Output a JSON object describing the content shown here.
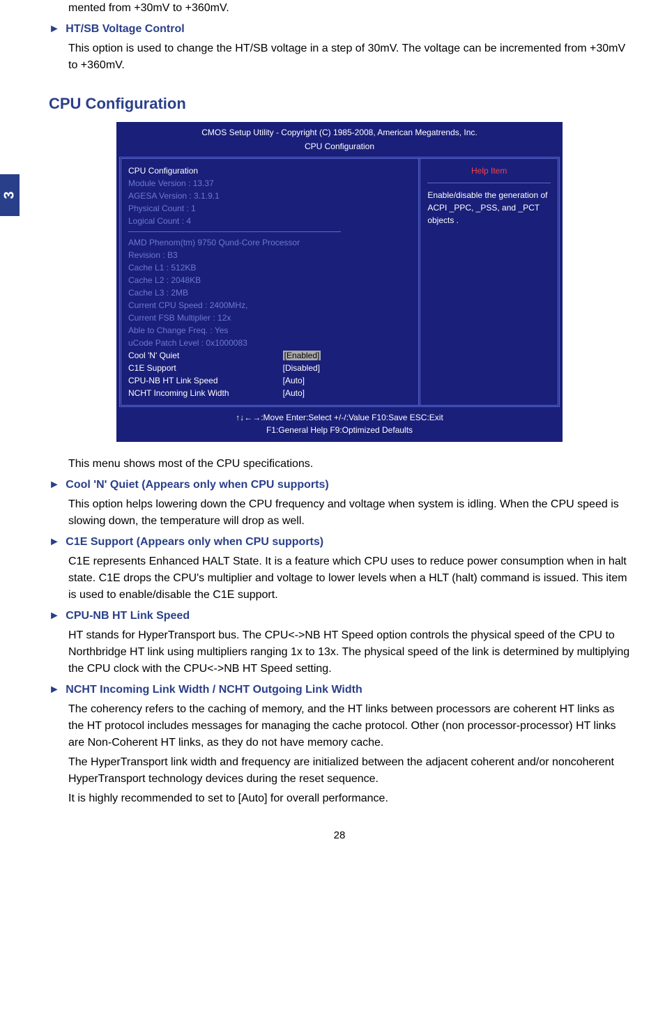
{
  "side_tab": "3",
  "intro_tail": "mented from +30mV to +360mV.",
  "htsb": {
    "title": "HT/SB Voltage Control",
    "body": "This option is used to change the HT/SB voltage in a step of 30mV. The voltage can be incremented from +30mV to +360mV."
  },
  "cpu_config_heading": "CPU Configuration",
  "bios": {
    "title": "CMOS Setup Utility - Copyright (C) 1985-2008, American Megatrends, Inc.",
    "subtitle": "CPU Configuration",
    "left": {
      "heading": "CPU Configuration",
      "module": "Module Version :  13.37",
      "agesa": "AGESA  Version :  3.1.9.1",
      "physical": "Physical Count :  1",
      "logical": "Logical Count :  4",
      "proc": "AMD Phenom(tm) 9750 Qund-Core Processor",
      "rev": "Revision :  B3",
      "l1": "Cache L1 :  512KB",
      "l2": "Cache L2 :  2048KB",
      "l3": "Cache L3 :  2MB",
      "speed": "Current CPU Speed  : 2400MHz,",
      "fsb": "Current FSB Multiplier  : 12x",
      "freq": "Able to Change Freq. : Yes",
      "ucode": "uCode Patch Level    : 0x1000083",
      "rows": [
        {
          "label": "Cool 'N' Quiet",
          "value": "[Enabled]",
          "selected": true
        },
        {
          "label": "C1E Support",
          "value": "[Disabled]",
          "selected": false
        },
        {
          "label": "CPU-NB HT Link Speed",
          "value": "[Auto]",
          "selected": false
        },
        {
          "label": "NCHT Incoming Link Width",
          "value": "[Auto]",
          "selected": false
        }
      ]
    },
    "right": {
      "help_title": "Help Item",
      "help_text": "Enable/disable the generation of ACPI _PPC,  _PSS, and _PCT objects ."
    },
    "footer1": "↑↓←→:Move   Enter:Select     +/-/:Value    F10:Save      ESC:Exit",
    "footer2": "F1:General Help                        F9:Optimized Defaults"
  },
  "after_bios_intro": "This menu shows most of the CPU specifications.",
  "cool": {
    "title": "Cool 'N' Quiet (Appears only when CPU supports)",
    "body": "This option helps lowering down the CPU frequency and voltage when system is idling. When the CPU speed is slowing down, the temperature will drop as well."
  },
  "c1e": {
    "title": "C1E Support (Appears only when CPU supports)",
    "body": "C1E represents Enhanced HALT State. It is a feature which CPU uses to reduce power consumption when in halt state. C1E drops the CPU's multiplier and voltage to lower levels when a HLT (halt) command is issued. This item is used to enable/disable the C1E support."
  },
  "cpunb": {
    "title": "CPU-NB HT Link Speed",
    "body": "HT stands for HyperTransport bus. The CPU<->NB HT Speed option controls the physical speed of the CPU to Northbridge HT link using multipliers ranging 1x to 13x. The physical speed of the link is determined by multiplying the CPU clock with the CPU<->NB HT Speed setting."
  },
  "ncht": {
    "title": "NCHT Incoming Link Width / NCHT Outgoing Link Width",
    "p1": "The coherency refers to the caching of memory, and the HT links between processors are coherent HT links as the HT protocol includes messages for managing the cache protocol. Other (non processor-processor) HT links are Non-Coherent HT links, as they do not have memory cache.",
    "p2": "The HyperTransport link width and frequency are initialized between the adjacent coherent and/or noncoherent HyperTransport technology devices during the reset sequence.",
    "p3": "It is highly recommended to set to [Auto] for overall performance."
  },
  "page_number": "28"
}
